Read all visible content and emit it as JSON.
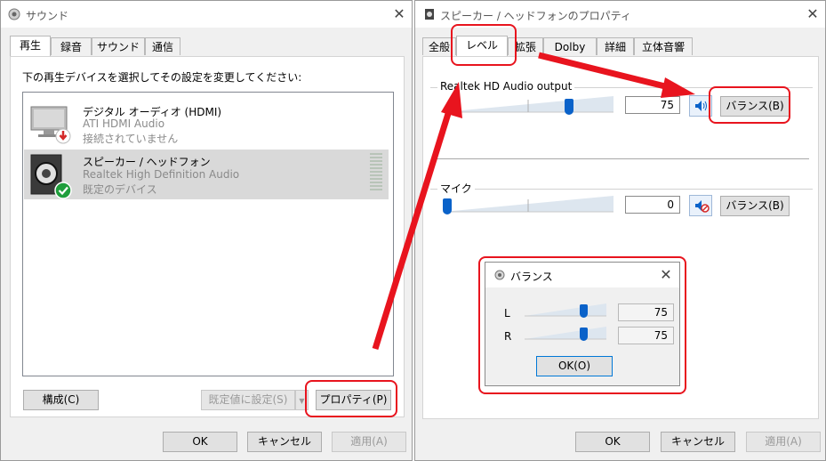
{
  "sound_window": {
    "title": "サウンド",
    "close": "✕",
    "tabs": [
      "再生",
      "録音",
      "サウンド",
      "通信"
    ],
    "instruction": "下の再生デバイスを選択してその設定を変更してください:",
    "devices": [
      {
        "name": "デジタル オーディオ (HDMI)",
        "driver": "ATI HDMI Audio",
        "status": "接続されていません",
        "icon": "monitor-disconnected-icon"
      },
      {
        "name": "スピーカー / ヘッドフォン",
        "driver": "Realtek High Definition Audio",
        "status": "既定のデバイス",
        "icon": "speaker-default-icon"
      }
    ],
    "configure_button": "構成(C)",
    "set_default_button": "既定値に設定(S)",
    "properties_button": "プロパティ(P)",
    "ok_button": "OK",
    "cancel_button": "キャンセル",
    "apply_button": "適用(A)"
  },
  "props_window": {
    "title": "スピーカー / ヘッドフォンのプロパティ",
    "close": "✕",
    "tabs": [
      "全般",
      "レベル",
      "拡張",
      "Dolby",
      "詳細",
      "立体音響"
    ],
    "output_label": "Realtek HD Audio output",
    "output_value": "75",
    "output_level": 75,
    "output_balance_button": "バランス(B)",
    "mic_label": "マイク",
    "mic_value": "0",
    "mic_level": 0,
    "mic_balance_button": "バランス(B)",
    "ok_button": "OK",
    "cancel_button": "キャンセル",
    "apply_button": "適用(A)"
  },
  "balance_dialog": {
    "title": "バランス",
    "close": "✕",
    "left_label": "L",
    "left_value": "75",
    "left_level": 75,
    "right_label": "R",
    "right_value": "75",
    "right_level": 75,
    "ok_button": "OK(O)"
  },
  "colors": {
    "annotation": "#e8141e",
    "accent": "#0a62c9",
    "default_check": "#1f9e3c",
    "disconnected": "#d42a2a"
  }
}
